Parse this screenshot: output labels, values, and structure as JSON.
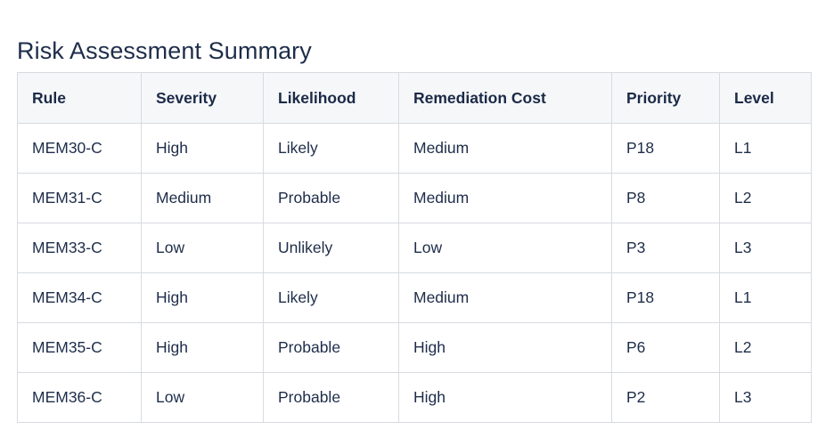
{
  "page": {
    "title": "Risk Assessment Summary",
    "background_color": "#ffffff",
    "title_color": "#1e2d4a"
  },
  "colors": {
    "border": "#d7dbe0",
    "header_background": "#f6f7f9",
    "text": "#1e2d4a",
    "risk_high": "#d81b1b",
    "risk_medium": "#c9a227",
    "risk_low": "#1a7a1a"
  },
  "table": {
    "columns": [
      {
        "key": "rule",
        "label": "Rule"
      },
      {
        "key": "severity",
        "label": "Severity"
      },
      {
        "key": "likelihood",
        "label": "Likelihood"
      },
      {
        "key": "remediation_cost",
        "label": "Remediation Cost"
      },
      {
        "key": "priority",
        "label": "Priority"
      },
      {
        "key": "level",
        "label": "Level"
      }
    ],
    "rows": [
      {
        "rule": "MEM30-C",
        "severity": "High",
        "likelihood": "Likely",
        "remediation_cost": "Medium",
        "priority": "P18",
        "level": "L1",
        "risk_class": "high"
      },
      {
        "rule": "MEM31-C",
        "severity": "Medium",
        "likelihood": "Probable",
        "remediation_cost": "Medium",
        "priority": "P8",
        "level": "L2",
        "risk_class": "med"
      },
      {
        "rule": "MEM33-C",
        "severity": "Low",
        "likelihood": "Unlikely",
        "remediation_cost": "Low",
        "priority": "P3",
        "level": "L3",
        "risk_class": "low"
      },
      {
        "rule": "MEM34-C",
        "severity": "High",
        "likelihood": "Likely",
        "remediation_cost": "Medium",
        "priority": "P18",
        "level": "L1",
        "risk_class": "high"
      },
      {
        "rule": "MEM35-C",
        "severity": "High",
        "likelihood": "Probable",
        "remediation_cost": "High",
        "priority": "P6",
        "level": "L2",
        "risk_class": "med"
      },
      {
        "rule": "MEM36-C",
        "severity": "Low",
        "likelihood": "Probable",
        "remediation_cost": "High",
        "priority": "P2",
        "level": "L3",
        "risk_class": "low"
      }
    ]
  }
}
